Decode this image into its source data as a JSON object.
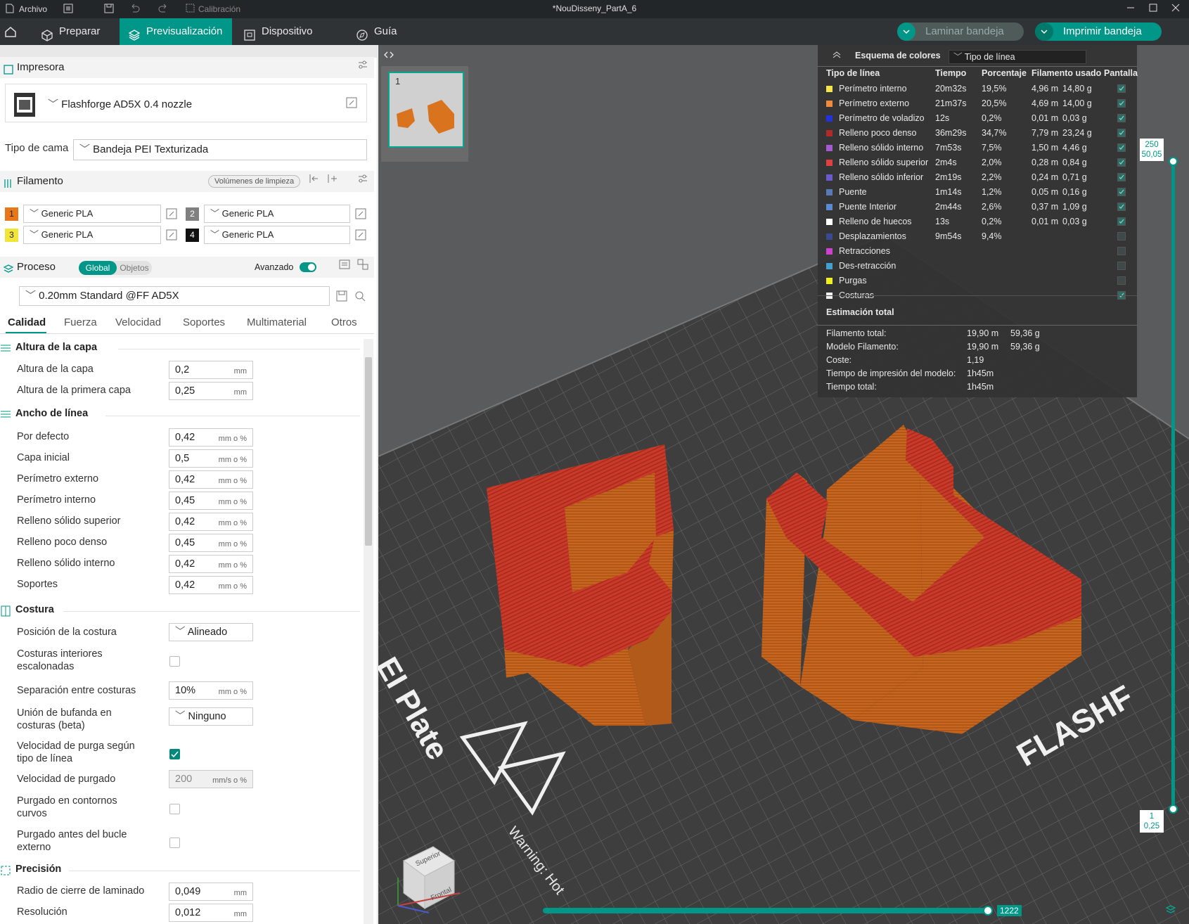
{
  "titlebar": {
    "archivo": "Archivo",
    "calibracion": "Calibración",
    "title": "*NouDisseny_PartA_6"
  },
  "nav": {
    "preparar": "Preparar",
    "previsualizacion": "Previsualización",
    "dispositivo": "Dispositivo",
    "guia": "Guía",
    "laminar": "Laminar bandeja",
    "imprimir": "Imprimir bandeja"
  },
  "printer": {
    "header": "Impresora",
    "name": "Flashforge AD5X 0.4 nozzle",
    "bed_label": "Tipo de cama",
    "bed_value": "Bandeja PEI Texturizada"
  },
  "filament": {
    "header": "Filamento",
    "purge_btn": "Volúmenes de limpieza",
    "slots": [
      {
        "num": "1",
        "name": "Generic PLA",
        "color": "#e8771a"
      },
      {
        "num": "2",
        "name": "Generic PLA",
        "color": "#808080"
      },
      {
        "num": "3",
        "name": "Generic PLA",
        "color": "#f2e53a"
      },
      {
        "num": "4",
        "name": "Generic PLA",
        "color": "#111111"
      }
    ]
  },
  "process": {
    "header": "Proceso",
    "global": "Global",
    "objetos": "Objetos",
    "avanzado": "Avanzado",
    "preset": "0.20mm Standard @FF AD5X",
    "tabs": [
      "Calidad",
      "Fuerza",
      "Velocidad",
      "Soportes",
      "Multimaterial",
      "Otros"
    ]
  },
  "groups": {
    "altura": "Altura de la capa",
    "ancho": "Ancho de línea",
    "costura": "Costura",
    "precision": "Precisión"
  },
  "altura_rows": [
    {
      "label": "Altura de la capa",
      "value": "0,2",
      "unit": "mm"
    },
    {
      "label": "Altura de la primera capa",
      "value": "0,25",
      "unit": "mm"
    }
  ],
  "ancho_rows": [
    {
      "label": "Por defecto",
      "value": "0,42",
      "unit": "mm o %"
    },
    {
      "label": "Capa inicial",
      "value": "0,5",
      "unit": "mm o %"
    },
    {
      "label": "Perímetro externo",
      "value": "0,42",
      "unit": "mm o %"
    },
    {
      "label": "Perímetro interno",
      "value": "0,45",
      "unit": "mm o %"
    },
    {
      "label": "Relleno sólido superior",
      "value": "0,42",
      "unit": "mm o %"
    },
    {
      "label": "Relleno poco denso",
      "value": "0,45",
      "unit": "mm o %"
    },
    {
      "label": "Relleno sólido interno",
      "value": "0,42",
      "unit": "mm o %"
    },
    {
      "label": "Soportes",
      "value": "0,42",
      "unit": "mm o %"
    }
  ],
  "costura": {
    "pos_label": "Posición de la costura",
    "pos_value": "Alineado",
    "interiores_l1": "Costuras interiores",
    "interiores_l2": "escalonadas",
    "sep_label": "Separación entre costuras",
    "sep_value": "10%",
    "sep_unit": "mm o %",
    "bufanda_l1": "Unión de bufanda en",
    "bufanda_l2": "costuras (beta)",
    "bufanda_value": "Ninguno",
    "vel_purga_l1": "Velocidad de purga según",
    "vel_purga_l2": "tipo de línea",
    "velpurgado_label": "Velocidad de purgado",
    "velpurgado_value": "200",
    "velpurgado_unit": "mm/s o %",
    "contornos_l1": "Purgado en contornos",
    "contornos_l2": "curvos",
    "bucle_l1": "Purgado antes del bucle",
    "bucle_l2": "externo"
  },
  "precision_rows": [
    {
      "label": "Radio de cierre de laminado",
      "value": "0,049",
      "unit": "mm"
    },
    {
      "label": "Resolución",
      "value": "0,012",
      "unit": "mm"
    }
  ],
  "plate": {
    "num": "1",
    "bed_text": "EI Plate",
    "brand": "FLASHF",
    "warning": "Warning: Hot"
  },
  "legend": {
    "title": "Esquema de colores",
    "mode": "Tipo de línea",
    "headers": [
      "Tipo de línea",
      "Tiempo",
      "Porcentaje",
      "Filamento usado",
      "Pantalla"
    ],
    "rows": [
      {
        "name": "Perímetro interno",
        "color": "#f5e44a",
        "time": "20m32s",
        "pct": "19,5%",
        "len": "4,96 m",
        "g": "14,80 g",
        "on": true
      },
      {
        "name": "Perímetro externo",
        "color": "#f08a3c",
        "time": "21m37s",
        "pct": "20,5%",
        "len": "4,69 m",
        "g": "14,00 g",
        "on": true
      },
      {
        "name": "Perímetro de voladizo",
        "color": "#2233dd",
        "time": "12s",
        "pct": "0,2%",
        "len": "0,01 m",
        "g": "0,03 g",
        "on": true
      },
      {
        "name": "Relleno poco denso",
        "color": "#b02a2a",
        "time": "36m29s",
        "pct": "34,7%",
        "len": "7,79 m",
        "g": "23,24 g",
        "on": true
      },
      {
        "name": "Relleno sólido interno",
        "color": "#a45ad0",
        "time": "7m53s",
        "pct": "7,5%",
        "len": "1,50 m",
        "g": "4,46 g",
        "on": true
      },
      {
        "name": "Relleno sólido superior",
        "color": "#e04040",
        "time": "2m4s",
        "pct": "2,0%",
        "len": "0,28 m",
        "g": "0,84 g",
        "on": true
      },
      {
        "name": "Relleno sólido inferior",
        "color": "#6a5acd",
        "time": "2m19s",
        "pct": "2,2%",
        "len": "0,24 m",
        "g": "0,71 g",
        "on": true
      },
      {
        "name": "Puente",
        "color": "#5a7ab5",
        "time": "1m14s",
        "pct": "1,2%",
        "len": "0,05 m",
        "g": "0,16 g",
        "on": true
      },
      {
        "name": "Puente Interior",
        "color": "#5a8ad0",
        "time": "2m44s",
        "pct": "2,6%",
        "len": "0,37 m",
        "g": "1,09 g",
        "on": true
      },
      {
        "name": "Relleno de huecos",
        "color": "#ffffff",
        "time": "13s",
        "pct": "0,2%",
        "len": "0,01 m",
        "g": "0,03 g",
        "on": true
      },
      {
        "name": "Desplazamientos",
        "color": "#3a4a90",
        "time": "9m54s",
        "pct": "9,4%",
        "len": "",
        "g": "",
        "on": false
      },
      {
        "name": "Retracciones",
        "color": "#d040d0",
        "time": "",
        "pct": "",
        "len": "",
        "g": "",
        "on": false
      },
      {
        "name": "Des-retracción",
        "color": "#40a0d0",
        "time": "",
        "pct": "",
        "len": "",
        "g": "",
        "on": false
      },
      {
        "name": "Purgas",
        "color": "#f0f020",
        "time": "",
        "pct": "",
        "len": "",
        "g": "",
        "on": false
      },
      {
        "name": "Costuras",
        "color": "#f0f0f0",
        "time": "",
        "pct": "",
        "len": "",
        "g": "",
        "on": true
      }
    ],
    "total_title": "Estimación total",
    "totals": [
      {
        "label": "Filamento total:",
        "a": "19,90 m",
        "b": "59,36 g"
      },
      {
        "label": "Modelo Filamento:",
        "a": "19,90 m",
        "b": "59,36 g"
      },
      {
        "label": "Coste:",
        "a": "1,19",
        "b": ""
      },
      {
        "label": "Tiempo de impresión del modelo:",
        "a": "1h45m",
        "b": ""
      },
      {
        "label": "Tiempo total:",
        "a": "1h45m",
        "b": ""
      }
    ]
  },
  "slider": {
    "top_layer": "250",
    "top_height": "50,05",
    "bot_layer": "1",
    "bot_height": "0,25",
    "move_value": "1222"
  },
  "cube": {
    "top": "Superior",
    "front": "Frontal"
  }
}
